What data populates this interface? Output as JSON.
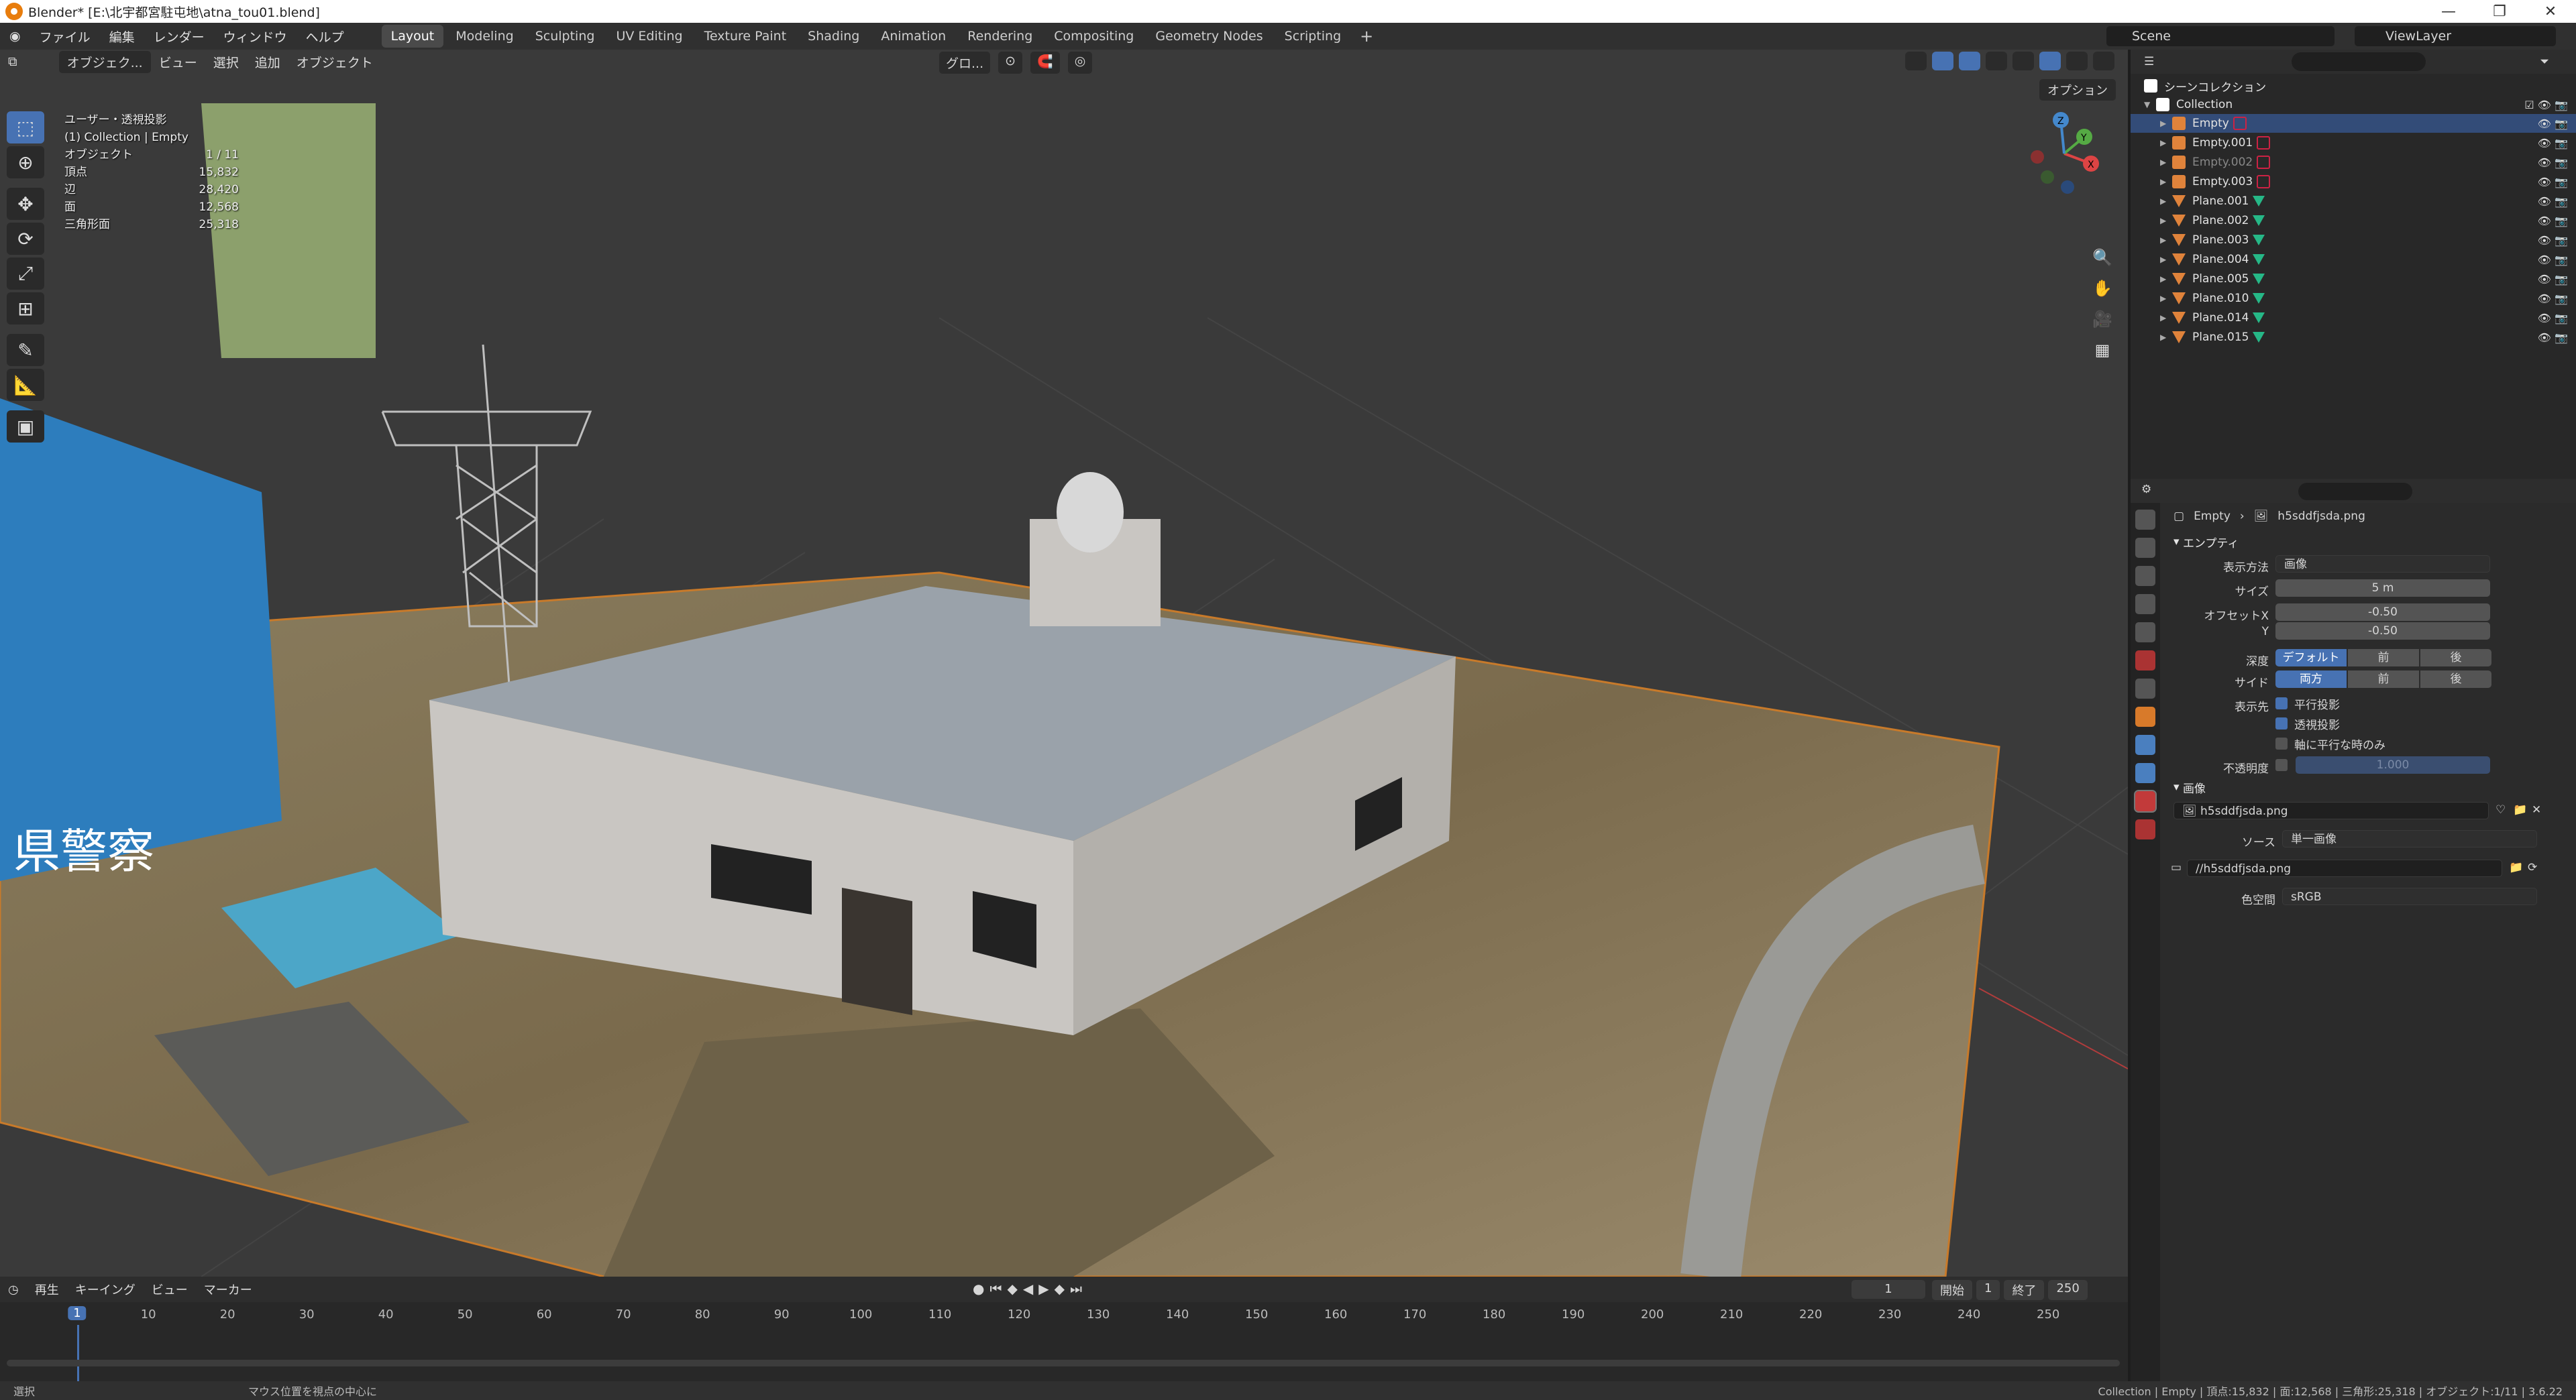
{
  "window": {
    "title": "Blender* [E:\\北宇都宮駐屯地\\atna_tou01.blend]",
    "controls": [
      "—",
      "❐",
      "✕"
    ]
  },
  "menubar": {
    "items": [
      "ファイル",
      "編集",
      "レンダー",
      "ウィンドウ",
      "ヘルプ"
    ],
    "workspaces": [
      "Layout",
      "Modeling",
      "Sculpting",
      "UV Editing",
      "Texture Paint",
      "Shading",
      "Animation",
      "Rendering",
      "Compositing",
      "Geometry Nodes",
      "Scripting"
    ],
    "active_workspace": "Layout",
    "plus": "+",
    "scene": "Scene",
    "view_layer": "ViewLayer"
  },
  "viewport": {
    "mode": "オブジェク...",
    "menus": [
      "ビュー",
      "選択",
      "追加",
      "オブジェクト"
    ],
    "transform": "グロ...",
    "options": "オプション",
    "overlay_info": {
      "view_name": "ユーザー・透視投影",
      "collection_path": "(1) Collection | Empty",
      "stats": [
        {
          "k": "オブジェクト",
          "v": "1 / 11"
        },
        {
          "k": "頂点",
          "v": "15,832"
        },
        {
          "k": "辺",
          "v": "28,420"
        },
        {
          "k": "面",
          "v": "12,568"
        },
        {
          "k": "三角形面",
          "v": "25,318"
        }
      ]
    },
    "billboard_text": "県警察",
    "gizmo_axes": [
      "X",
      "Y",
      "Z"
    ]
  },
  "timeline": {
    "menus": [
      "再生",
      "キーイング",
      "ビュー",
      "マーカー"
    ],
    "current_frame": "1",
    "start_label": "開始",
    "start": "1",
    "end_label": "終了",
    "end": "250",
    "ticks": [
      "1",
      "10",
      "20",
      "30",
      "40",
      "50",
      "60",
      "70",
      "80",
      "90",
      "100",
      "110",
      "120",
      "130",
      "140",
      "150",
      "160",
      "170",
      "180",
      "190",
      "200",
      "210",
      "220",
      "230",
      "240",
      "250"
    ]
  },
  "statusbar": {
    "select": "選択",
    "hint": "マウス位置を視点の中心に",
    "info": "Collection | Empty | 頂点:15,832 | 面:12,568 | 三角形:25,318 | オブジェクト:1/11 | 3.6.22"
  },
  "outliner": {
    "root": "シーンコレクション",
    "collection": "Collection",
    "items": [
      {
        "name": "Empty",
        "type": "empty",
        "selected": true,
        "dim": false
      },
      {
        "name": "Empty.001",
        "type": "empty",
        "selected": false,
        "dim": false
      },
      {
        "name": "Empty.002",
        "type": "empty",
        "selected": false,
        "dim": true
      },
      {
        "name": "Empty.003",
        "type": "empty",
        "selected": false,
        "dim": false
      },
      {
        "name": "Plane.001",
        "type": "mesh",
        "selected": false,
        "dim": false
      },
      {
        "name": "Plane.002",
        "type": "mesh",
        "selected": false,
        "dim": false
      },
      {
        "name": "Plane.003",
        "type": "mesh",
        "selected": false,
        "dim": false
      },
      {
        "name": "Plane.004",
        "type": "mesh",
        "selected": false,
        "dim": false
      },
      {
        "name": "Plane.005",
        "type": "mesh",
        "selected": false,
        "dim": false
      },
      {
        "name": "Plane.010",
        "type": "mesh",
        "selected": false,
        "dim": false
      },
      {
        "name": "Plane.014",
        "type": "mesh",
        "selected": false,
        "dim": false
      },
      {
        "name": "Plane.015",
        "type": "mesh",
        "selected": false,
        "dim": false
      }
    ]
  },
  "properties": {
    "breadcrumb_object": "Empty",
    "breadcrumb_data": "h5sddfjsda.png",
    "empty_panel": {
      "title": "エンプティ",
      "display_label": "表示方法",
      "display_value": "画像",
      "size_label": "サイズ",
      "size_value": "5 m",
      "offset_x_label": "オフセットX",
      "offset_x_value": "-0.50",
      "offset_y_label": "Y",
      "offset_y_value": "-0.50",
      "depth_label": "深度",
      "depth_options": [
        "デフォルト",
        "前",
        "後"
      ],
      "side_label": "サイド",
      "side_options": [
        "両方",
        "前",
        "後"
      ],
      "show_label": "表示先",
      "show_ortho": "平行投影",
      "show_persp": "透視投影",
      "show_axis": "軸に平行な時のみ",
      "opacity_label": "不透明度",
      "opacity_value": "1.000"
    },
    "image_panel": {
      "title": "画像",
      "image_name": "h5sddfjsda.png",
      "source_label": "ソース",
      "source_value": "単一画像",
      "filepath": "//h5sddfjsda.png",
      "colorspace_label": "色空間",
      "colorspace_value": "sRGB"
    }
  },
  "colors": {
    "accent": "#4772b3",
    "selected_row": "#334c78",
    "object_orange": "#e0833b",
    "mesh_green": "#26b887"
  }
}
